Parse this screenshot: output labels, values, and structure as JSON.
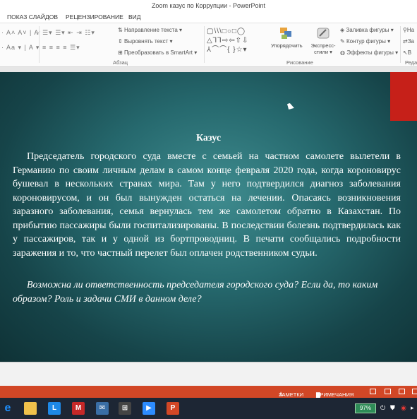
{
  "window": {
    "title": "Zoom казус по Коррупции - PowerPoint"
  },
  "tabs": [
    "ПОКАЗ СЛАЙДОВ",
    "РЕЦЕНЗИРОВАНИЕ",
    "ВИД"
  ],
  "ribbon": {
    "paragraph": {
      "text_direction": "Направление текста",
      "align_text": "Выровнять текст",
      "convert_smartart": "Преобразовать в SmartArt",
      "group_label": "Абзац"
    },
    "drawing": {
      "arrange": "Упорядочить",
      "quick_styles_1": "Экспресс-",
      "quick_styles_2": "стили",
      "shape_fill": "Заливка фигуры",
      "shape_outline": "Контур фигуры",
      "shape_effects": "Эффекты фигуры",
      "group_label": "Рисование"
    },
    "editing": {
      "find": "На",
      "replace": "За",
      "select": "В",
      "group_label": "Реда"
    }
  },
  "slide": {
    "title": "Казус",
    "body": "Председатель городского суда вместе с семьей на частном самолете вылетели в Германию по своим личным делам в самом конце февраля 2020 года, когда короновирус бушевал в нескольких странах мира. Там у него подтвердился диагноз заболевания короновирусом, и он был вынужден остаться на лечении.  Опасаясь возникновения заразного заболевания, семья вернулась тем же самолетом обратно в Казахстан. По прибытию пассажиры были госпитализированы. В последствии болезнь подтвердилась как у пассажиров, так и у одной из бортпроводниц. В печати сообщались подробности заражения и то, что частный перелет был оплачен родственником судьи.",
    "question": "Возможна ли ответственность председателя городского суда? Если да, то каким образом?  Роль и задачи СМИ в данном деле?"
  },
  "statusbar": {
    "notes": "ЗАМЕТКИ",
    "comments": "ПРИМЕЧАНИЯ"
  },
  "taskbar": {
    "battery": "97%"
  },
  "colors": {
    "slide_bg": "#1f5a5e",
    "accent_red": "#c62019",
    "status_bar": "#d24726",
    "taskbar": "#1d2634"
  }
}
